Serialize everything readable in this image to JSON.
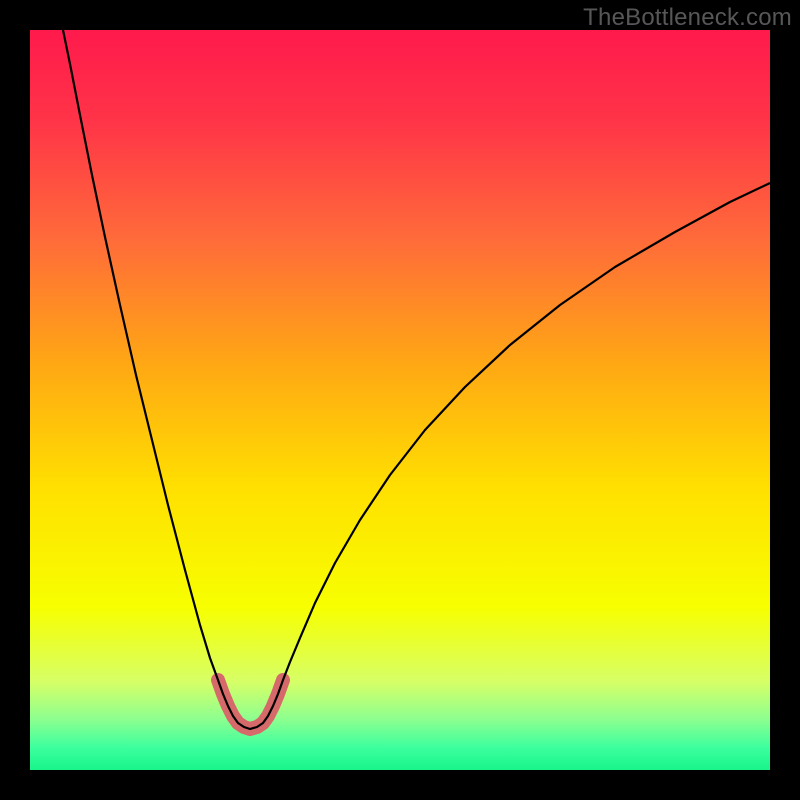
{
  "watermark": "TheBottleneck.com",
  "chart_data": {
    "type": "line",
    "title": "",
    "xlabel": "",
    "ylabel": "",
    "xlim": [
      30,
      770
    ],
    "ylim": [
      30,
      770
    ],
    "gradient_stops": [
      {
        "offset": 0.0,
        "color": "#ff1a4c"
      },
      {
        "offset": 0.12,
        "color": "#ff3348"
      },
      {
        "offset": 0.28,
        "color": "#ff6a3a"
      },
      {
        "offset": 0.45,
        "color": "#ffa714"
      },
      {
        "offset": 0.62,
        "color": "#ffe000"
      },
      {
        "offset": 0.78,
        "color": "#f7ff00"
      },
      {
        "offset": 0.88,
        "color": "#d7ff66"
      },
      {
        "offset": 0.93,
        "color": "#8fff8f"
      },
      {
        "offset": 0.97,
        "color": "#3cff9e"
      },
      {
        "offset": 1.0,
        "color": "#18f58a"
      }
    ],
    "series": [
      {
        "name": "main-curve-left",
        "type": "line",
        "stroke": "#000000",
        "stroke_width": 2.2,
        "points": [
          [
            63,
            30
          ],
          [
            70,
            64
          ],
          [
            80,
            115
          ],
          [
            92,
            175
          ],
          [
            105,
            237
          ],
          [
            120,
            305
          ],
          [
            136,
            375
          ],
          [
            152,
            440
          ],
          [
            168,
            505
          ],
          [
            185,
            570
          ],
          [
            200,
            625
          ],
          [
            210,
            658
          ],
          [
            218,
            680
          ]
        ]
      },
      {
        "name": "main-curve-right",
        "type": "line",
        "stroke": "#000000",
        "stroke_width": 2.2,
        "points": [
          [
            283,
            680
          ],
          [
            290,
            662
          ],
          [
            300,
            638
          ],
          [
            315,
            603
          ],
          [
            335,
            563
          ],
          [
            360,
            520
          ],
          [
            390,
            475
          ],
          [
            425,
            430
          ],
          [
            465,
            387
          ],
          [
            510,
            345
          ],
          [
            560,
            305
          ],
          [
            615,
            267
          ],
          [
            675,
            232
          ],
          [
            730,
            202
          ],
          [
            770,
            183
          ]
        ]
      },
      {
        "name": "bottom-u-highlight",
        "type": "line",
        "stroke": "#d66a6a",
        "stroke_width": 14,
        "stroke_linecap": "round",
        "points": [
          [
            218,
            680
          ],
          [
            223,
            694
          ],
          [
            228,
            706
          ],
          [
            233,
            716
          ],
          [
            238,
            723
          ],
          [
            244,
            727
          ],
          [
            250,
            729
          ],
          [
            257,
            727
          ],
          [
            263,
            723
          ],
          [
            268,
            716
          ],
          [
            273,
            706
          ],
          [
            278,
            694
          ],
          [
            283,
            680
          ]
        ]
      },
      {
        "name": "full-curve-envelope",
        "type": "line",
        "stroke": "#000000",
        "stroke_width": 2.2,
        "points": [
          [
            63,
            30
          ],
          [
            70,
            64
          ],
          [
            80,
            115
          ],
          [
            92,
            175
          ],
          [
            105,
            237
          ],
          [
            120,
            305
          ],
          [
            136,
            375
          ],
          [
            152,
            440
          ],
          [
            168,
            505
          ],
          [
            185,
            570
          ],
          [
            200,
            625
          ],
          [
            210,
            658
          ],
          [
            218,
            680
          ],
          [
            223,
            694
          ],
          [
            228,
            706
          ],
          [
            233,
            716
          ],
          [
            238,
            723
          ],
          [
            244,
            727
          ],
          [
            250,
            729
          ],
          [
            257,
            727
          ],
          [
            263,
            723
          ],
          [
            268,
            716
          ],
          [
            273,
            706
          ],
          [
            278,
            694
          ],
          [
            283,
            680
          ],
          [
            290,
            662
          ],
          [
            300,
            638
          ],
          [
            315,
            603
          ],
          [
            335,
            563
          ],
          [
            360,
            520
          ],
          [
            390,
            475
          ],
          [
            425,
            430
          ],
          [
            465,
            387
          ],
          [
            510,
            345
          ],
          [
            560,
            305
          ],
          [
            615,
            267
          ],
          [
            675,
            232
          ],
          [
            730,
            202
          ],
          [
            770,
            183
          ]
        ]
      }
    ]
  }
}
